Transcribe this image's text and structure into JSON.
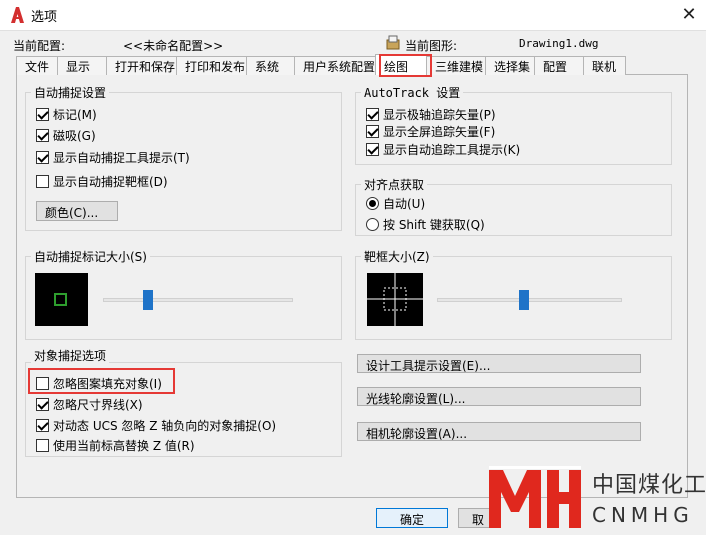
{
  "window": {
    "title": "选项",
    "close_glyph": "✕"
  },
  "profile": {
    "label": "当前配置:",
    "value": "<<未命名配置>>"
  },
  "drawing": {
    "label": "当前图形:",
    "value": "Drawing1.dwg"
  },
  "tabs": [
    {
      "label": "文件",
      "active": false
    },
    {
      "label": "显示",
      "active": false
    },
    {
      "label": "打开和保存",
      "active": false
    },
    {
      "label": "打印和发布",
      "active": false
    },
    {
      "label": "系统",
      "active": false
    },
    {
      "label": "用户系统配置",
      "active": false
    },
    {
      "label": "绘图",
      "active": true
    },
    {
      "label": "三维建模",
      "active": false
    },
    {
      "label": "选择集",
      "active": false
    },
    {
      "label": "配置",
      "active": false
    },
    {
      "label": "联机",
      "active": false
    }
  ],
  "autosnap": {
    "title": "自动捕捉设置",
    "items": [
      {
        "label": "标记(M)",
        "checked": true
      },
      {
        "label": "磁吸(G)",
        "checked": true
      },
      {
        "label": "显示自动捕捉工具提示(T)",
        "checked": true
      },
      {
        "label": "显示自动捕捉靶框(D)",
        "checked": false
      }
    ],
    "color_button": "颜色(C)..."
  },
  "autotrack": {
    "title": "AutoTrack 设置",
    "items": [
      {
        "label": "显示极轴追踪矢量(P)",
        "checked": true
      },
      {
        "label": "显示全屏追踪矢量(F)",
        "checked": true
      },
      {
        "label": "显示自动追踪工具提示(K)",
        "checked": true
      }
    ]
  },
  "alignment": {
    "title": "对齐点获取",
    "options": [
      {
        "label": "自动(U)",
        "checked": true
      },
      {
        "label": "按 Shift 键获取(Q)",
        "checked": false
      }
    ]
  },
  "marker_size": {
    "title": "自动捕捉标记大小(S)",
    "level": 0.22
  },
  "aperture_size": {
    "title": "靶框大小(Z)",
    "level": 0.47
  },
  "osnap": {
    "title": "对象捕捉选项",
    "items": [
      {
        "label": "忽略图案填充对象(I)",
        "checked": false
      },
      {
        "label": "忽略尺寸界线(X)",
        "checked": true
      },
      {
        "label": "对动态 UCS 忽略 Z 轴负向的对象捕捉(O)",
        "checked": true
      },
      {
        "label": "使用当前标高替换 Z 值(R)",
        "checked": false
      }
    ]
  },
  "side_buttons": [
    "设计工具提示设置(E)...",
    "光线轮廓设置(L)...",
    "相机轮廓设置(A)..."
  ],
  "footer": {
    "ok": "确定",
    "cancel": "取"
  },
  "watermark": {
    "cn": "中国煤化工",
    "en": "CNMHG"
  },
  "colors": {
    "accent": "#1e73c8",
    "highlight": "#e53935",
    "marker": "#2e9e2e",
    "logo": "#e0281e"
  }
}
